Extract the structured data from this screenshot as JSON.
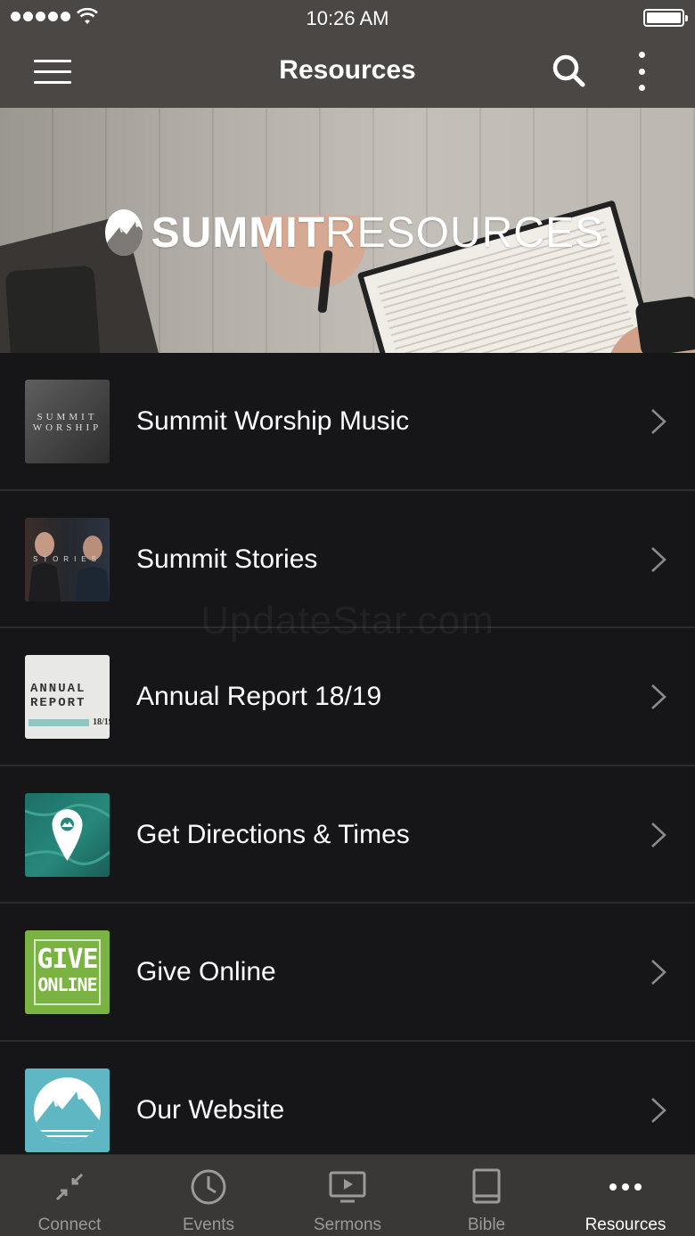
{
  "status_bar": {
    "time": "10:26 AM"
  },
  "nav": {
    "title": "Resources"
  },
  "banner": {
    "brand_bold": "SUMMIT",
    "brand_light": "RESOURCES"
  },
  "resources": [
    {
      "label": "Summit Worship Music",
      "thumb_text": "SUMMIT WORSHIP",
      "icon": "worship-album-thumbnail"
    },
    {
      "label": "Summit Stories",
      "thumb_text": "STORIES",
      "icon": "stories-thumbnail"
    },
    {
      "label": "Annual Report 18/19",
      "thumb_text": "ANNUAL REPORT",
      "thumb_year": "18/19",
      "icon": "annual-report-thumbnail"
    },
    {
      "label": "Get Directions & Times",
      "icon": "map-pin-icon"
    },
    {
      "label": "Give Online",
      "thumb_text_1": "GIVE",
      "thumb_text_2": "ONLINE",
      "icon": "give-online-thumbnail"
    },
    {
      "label": "Our Website",
      "icon": "summit-logo-icon"
    }
  ],
  "watermark": "UpdateStar.com",
  "tabs": [
    {
      "label": "Connect",
      "icon": "connect-icon",
      "active": false
    },
    {
      "label": "Events",
      "icon": "clock-icon",
      "active": false
    },
    {
      "label": "Sermons",
      "icon": "screen-play-icon",
      "active": false
    },
    {
      "label": "Bible",
      "icon": "book-icon",
      "active": false
    },
    {
      "label": "Resources",
      "icon": "more-dots-icon",
      "active": true
    }
  ],
  "colors": {
    "header_bg": "#4a4744",
    "list_bg": "#161618",
    "tabbar_bg": "#3a3836",
    "tab_inactive": "#9c9996",
    "tab_active": "#ffffff"
  }
}
